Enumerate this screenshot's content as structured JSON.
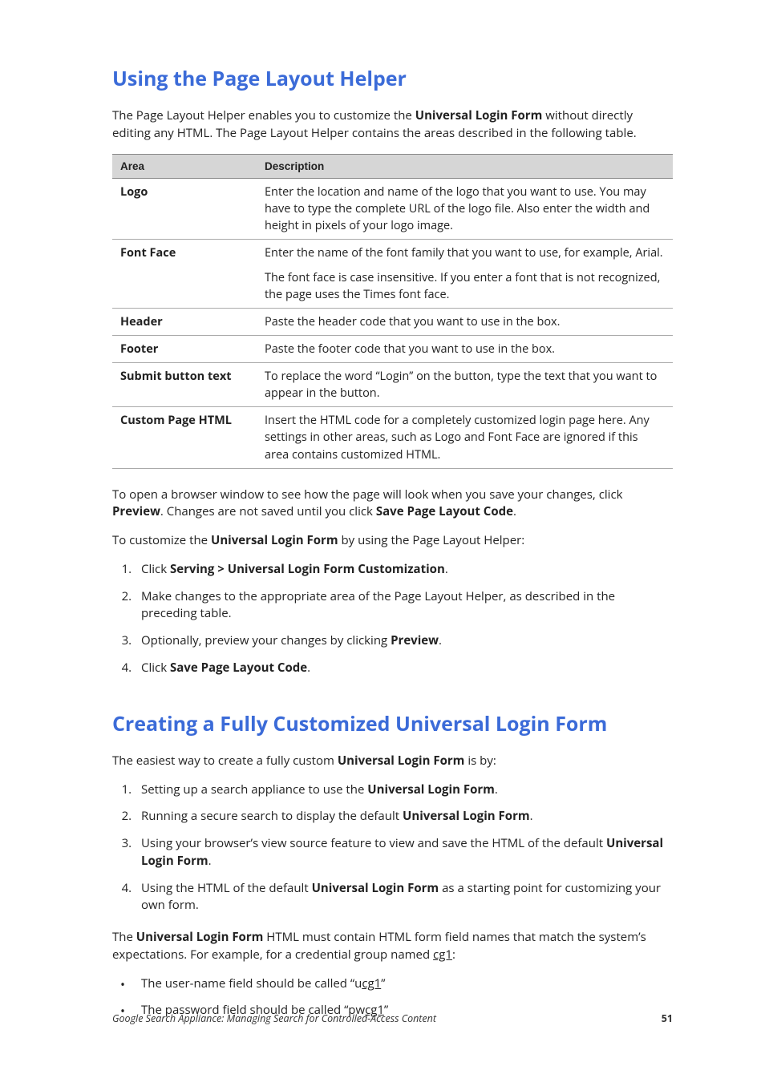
{
  "section1": {
    "heading": "Using the Page Layout Helper",
    "intro_pre": "The Page Layout Helper enables you to customize the ",
    "intro_bold": "Universal Login Form",
    "intro_post": " without directly editing any HTML. The Page Layout Helper contains the areas described in the following table.",
    "table": {
      "col1": "Area",
      "col2": "Description",
      "rows": [
        {
          "area": "Logo",
          "desc": "Enter the location and name of the logo that you want to use. You may have to type the complete URL of the logo file. Also enter the width and height in pixels of your logo image."
        },
        {
          "area": "Font Face",
          "desc": "Enter the name of the font family that you want to use, for example, Arial.",
          "desc2": "The font face is case insensitive. If you enter a font that is not recognized, the page uses the Times font face."
        },
        {
          "area": "Header",
          "desc": "Paste the header code that you want to use in the box."
        },
        {
          "area": "Footer",
          "desc": "Paste the footer code that you want to use in the box."
        },
        {
          "area": "Submit button text",
          "desc": "To replace the word “Login” on the button, type the text that you want to appear in the button."
        },
        {
          "area": "Custom Page HTML",
          "desc": "Insert the HTML code for a completely customized login page here. Any settings in other areas, such as Logo and Font Face are ignored if this area contains customized HTML."
        }
      ]
    },
    "p2_pre": "To open a browser window to see how the page will look when you save your changes, click ",
    "p2_b1": "Preview",
    "p2_mid": ". Changes are not saved until you click ",
    "p2_b2": "Save Page Layout Code",
    "p2_post": ".",
    "p3_pre": "To customize the ",
    "p3_b": "Universal Login Form",
    "p3_post": " by using the Page Layout Helper:",
    "steps": {
      "s1_pre": "Click ",
      "s1_b": "Serving > Universal Login Form Customization",
      "s1_post": ".",
      "s2": "Make changes to the appropriate area of the Page Layout Helper, as described in the preceding table.",
      "s3_pre": "Optionally, preview your changes by clicking ",
      "s3_b": "Preview",
      "s3_post": ".",
      "s4_pre": "Click ",
      "s4_b": "Save Page Layout Code",
      "s4_post": "."
    }
  },
  "section2": {
    "heading": "Creating a Fully Customized Universal Login Form",
    "intro_pre": "The easiest way to create a fully custom ",
    "intro_b": "Universal Login Form",
    "intro_post": " is by:",
    "steps": {
      "s1_pre": "Setting up a search appliance to use the ",
      "s1_b": "Universal Login Form",
      "s1_post": ".",
      "s2_pre": "Running a secure search to display the default ",
      "s2_b": "Universal Login Form",
      "s2_post": ".",
      "s3_pre": "Using your browser’s view source feature to view and save the HTML of the default ",
      "s3_b": "Universal Login Form",
      "s3_post": ".",
      "s4_pre": "Using the HTML of the default ",
      "s4_b": "Universal Login Form",
      "s4_post": " as a starting point for customizing your own form."
    },
    "p2_pre": "The ",
    "p2_b": "Universal Login Form",
    "p2_mid": " HTML must contain HTML form field names that match the system’s expectations. For example, for a credential group named ",
    "p2_u": "cg1",
    "p2_post": ":",
    "bullets": {
      "b1_pre": "The user-name field should be called “u",
      "b1_u": "cg1",
      "b1_post": "”",
      "b2_pre": "The password field should be called “pw",
      "b2_u": "cg1",
      "b2_post": "”"
    }
  },
  "footer": {
    "title": "Google Search Appliance: Managing Search for Controlled-Access Content",
    "page": "51"
  }
}
